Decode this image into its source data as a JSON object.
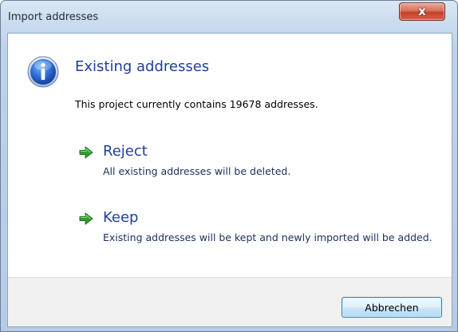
{
  "window": {
    "title": "Import addresses",
    "close_glyph": "x"
  },
  "dialog": {
    "icon": "info-icon",
    "heading": "Existing addresses",
    "description": "This project currently contains 19678 addresses.",
    "options": [
      {
        "icon": "green-arrow-icon",
        "title": "Reject",
        "description": "All existing addresses will be deleted."
      },
      {
        "icon": "green-arrow-icon",
        "title": "Keep",
        "description": "Existing addresses will be kept and newly imported will be added."
      }
    ]
  },
  "footer": {
    "cancel_label": "Abbrechen"
  },
  "colors": {
    "heading": "#1f3f9a",
    "arrow": "#2e9e2e",
    "close_button": "#c4412a"
  }
}
